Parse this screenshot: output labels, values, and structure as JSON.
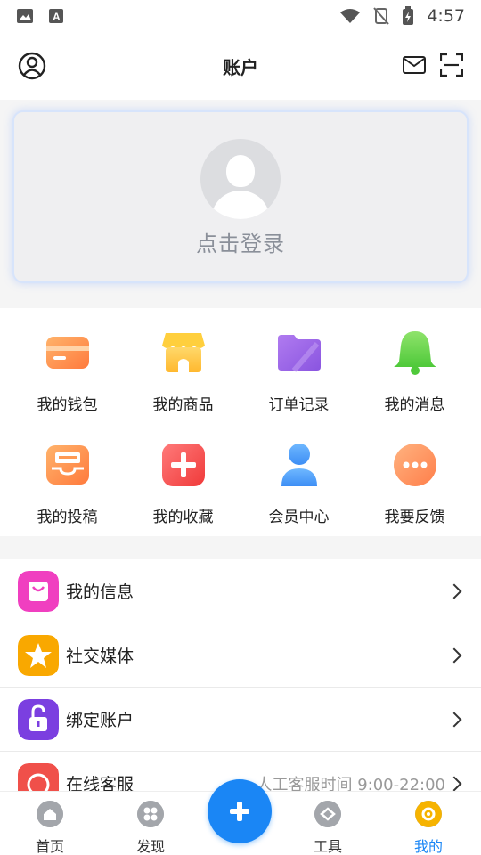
{
  "status": {
    "time": "4:57"
  },
  "header": {
    "title": "账户"
  },
  "login": {
    "prompt": "点击登录"
  },
  "grid": {
    "items": [
      {
        "label": "我的钱包",
        "icon": "wallet-icon"
      },
      {
        "label": "我的商品",
        "icon": "store-icon"
      },
      {
        "label": "订单记录",
        "icon": "folder-icon"
      },
      {
        "label": "我的消息",
        "icon": "bell-icon"
      },
      {
        "label": "我的投稿",
        "icon": "inbox-icon"
      },
      {
        "label": "我的收藏",
        "icon": "plus-box-icon"
      },
      {
        "label": "会员中心",
        "icon": "person-icon"
      },
      {
        "label": "我要反馈",
        "icon": "more-dots-icon"
      }
    ]
  },
  "menu": {
    "items": [
      {
        "label": "我的信息",
        "icon": "bag-icon",
        "extra": ""
      },
      {
        "label": "社交媒体",
        "icon": "star-icon",
        "extra": ""
      },
      {
        "label": "绑定账户",
        "icon": "unlock-icon",
        "extra": ""
      },
      {
        "label": "在线客服",
        "icon": "support-icon",
        "extra": "人工客服时间 9:00-22:00"
      }
    ]
  },
  "tabbar": {
    "items": [
      {
        "label": "首页",
        "icon": "home-icon"
      },
      {
        "label": "发现",
        "icon": "discover-icon"
      },
      {
        "label": "工具",
        "icon": "tools-icon"
      },
      {
        "label": "我的",
        "icon": "mine-icon"
      }
    ],
    "active": "我的"
  },
  "colors": {
    "accent": "#1a86f5",
    "active_tab": "#f6b300"
  }
}
